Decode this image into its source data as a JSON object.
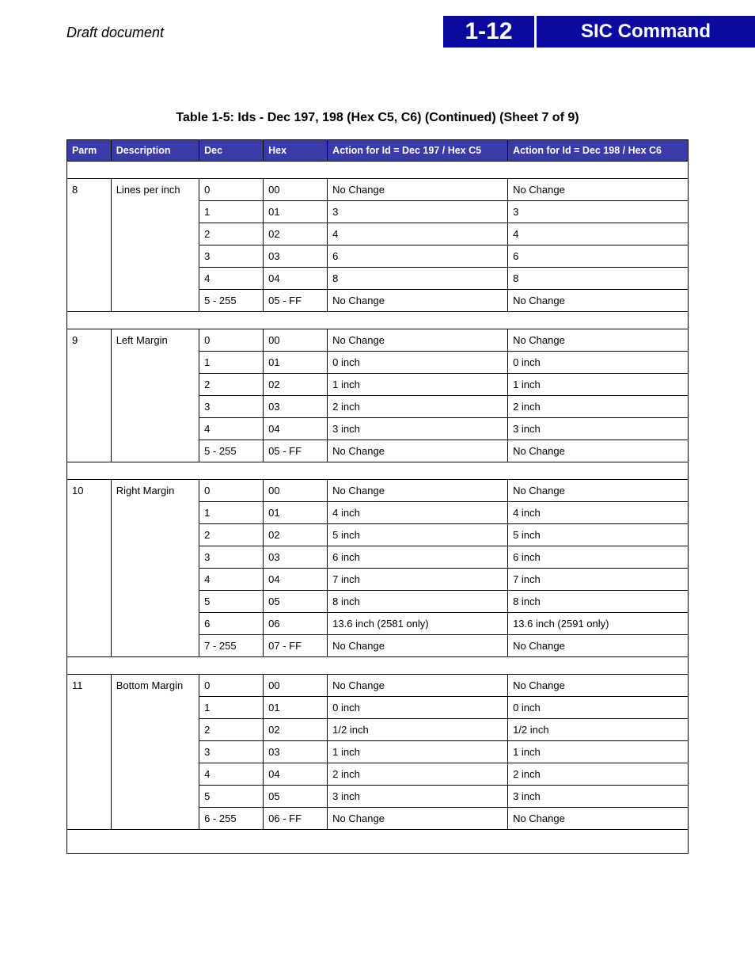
{
  "header": {
    "draft_label": "Draft document",
    "page_number": "1-12",
    "title": "SIC Command"
  },
  "table": {
    "caption": "Table 1-5:  Ids - Dec 197, 198 (Hex C5, C6) (Continued) (Sheet 7 of 9)",
    "columns": {
      "parm": "Parm",
      "description": "Description",
      "dec": "Dec",
      "hex": "Hex",
      "action_c5": "Action for Id = Dec 197 / Hex C5",
      "action_c6": "Action for Id = Dec 198 / Hex C6"
    },
    "groups": [
      {
        "parm": "8",
        "description": "Lines per inch",
        "rows": [
          {
            "dec": "0",
            "hex": "00",
            "a1": "No Change",
            "a2": "No Change"
          },
          {
            "dec": "1",
            "hex": "01",
            "a1": "3",
            "a2": "3"
          },
          {
            "dec": "2",
            "hex": "02",
            "a1": "4",
            "a2": "4"
          },
          {
            "dec": "3",
            "hex": "03",
            "a1": "6",
            "a2": "6"
          },
          {
            "dec": "4",
            "hex": "04",
            "a1": "8",
            "a2": "8"
          },
          {
            "dec": "5 - 255",
            "hex": "05 - FF",
            "a1": "No Change",
            "a2": "No Change"
          }
        ]
      },
      {
        "parm": "9",
        "description": "Left Margin",
        "rows": [
          {
            "dec": "0",
            "hex": "00",
            "a1": "No Change",
            "a2": "No Change"
          },
          {
            "dec": "1",
            "hex": "01",
            "a1": "0 inch",
            "a2": "0 inch"
          },
          {
            "dec": "2",
            "hex": "02",
            "a1": "1 inch",
            "a2": "1 inch"
          },
          {
            "dec": "3",
            "hex": "03",
            "a1": "2 inch",
            "a2": "2 inch"
          },
          {
            "dec": "4",
            "hex": "04",
            "a1": "3 inch",
            "a2": "3 inch"
          },
          {
            "dec": "5 - 255",
            "hex": "05 - FF",
            "a1": "No Change",
            "a2": "No Change"
          }
        ]
      },
      {
        "parm": "10",
        "description": "Right Margin",
        "rows": [
          {
            "dec": "0",
            "hex": "00",
            "a1": "No Change",
            "a2": "No Change"
          },
          {
            "dec": "1",
            "hex": "01",
            "a1": "4 inch",
            "a2": "4 inch"
          },
          {
            "dec": "2",
            "hex": "02",
            "a1": "5 inch",
            "a2": "5 inch"
          },
          {
            "dec": "3",
            "hex": "03",
            "a1": "6 inch",
            "a2": "6 inch"
          },
          {
            "dec": "4",
            "hex": "04",
            "a1": "7 inch",
            "a2": "7 inch"
          },
          {
            "dec": "5",
            "hex": "05",
            "a1": "8 inch",
            "a2": "8 inch"
          },
          {
            "dec": "6",
            "hex": "06",
            "a1": "13.6 inch (2581 only)",
            "a2": "13.6 inch (2591 only)"
          },
          {
            "dec": "7 - 255",
            "hex": "07 - FF",
            "a1": "No Change",
            "a2": "No Change"
          }
        ]
      },
      {
        "parm": "11",
        "description": "Bottom Margin",
        "rows": [
          {
            "dec": "0",
            "hex": "00",
            "a1": "No Change",
            "a2": "No Change"
          },
          {
            "dec": "1",
            "hex": "01",
            "a1": "0 inch",
            "a2": "0 inch"
          },
          {
            "dec": "2",
            "hex": "02",
            "a1": "1/2 inch",
            "a2": "1/2 inch"
          },
          {
            "dec": "3",
            "hex": "03",
            "a1": "1 inch",
            "a2": "1 inch"
          },
          {
            "dec": "4",
            "hex": "04",
            "a1": "2 inch",
            "a2": "2 inch"
          },
          {
            "dec": "5",
            "hex": "05",
            "a1": "3 inch",
            "a2": "3 inch"
          },
          {
            "dec": "6 - 255",
            "hex": "06 - FF",
            "a1": "No Change",
            "a2": "No Change"
          }
        ]
      }
    ]
  }
}
